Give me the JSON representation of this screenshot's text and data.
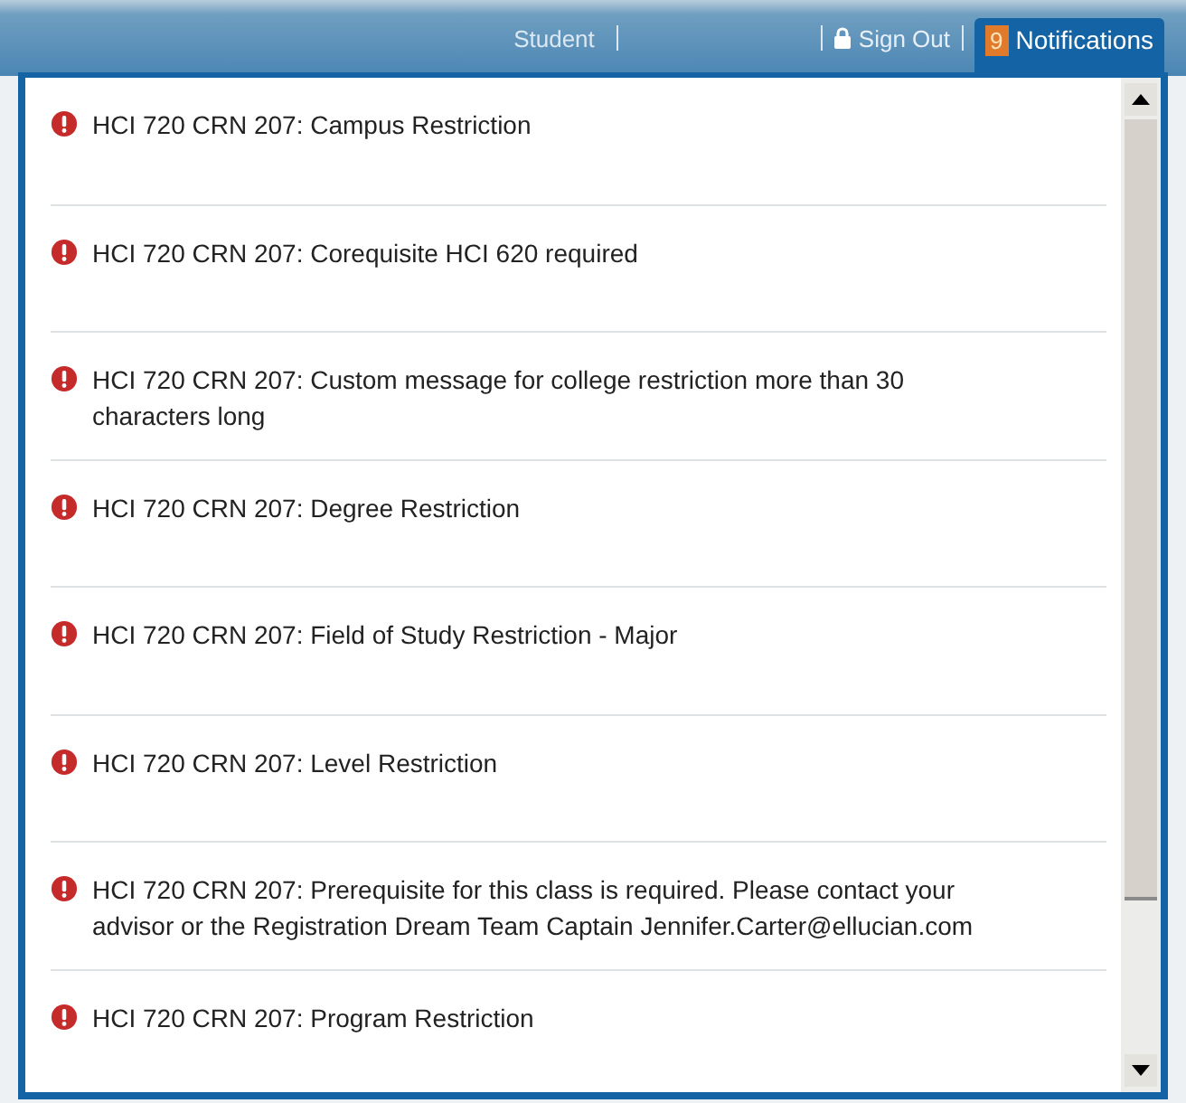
{
  "header": {
    "user": "Student",
    "sign_out": "Sign Out",
    "notifications": {
      "label": "Notifications",
      "count": "9",
      "selected": true
    }
  },
  "notifications": [
    {
      "message": "HCI 720 CRN 207: Campus Restriction"
    },
    {
      "message": "HCI 720 CRN 207: Corequisite HCI 620 required"
    },
    {
      "message": "HCI 720 CRN 207: Custom message for college restriction more than 30 characters long"
    },
    {
      "message": "HCI 720 CRN 207: Degree Restriction"
    },
    {
      "message": "HCI 720 CRN 207: Field of Study Restriction - Major"
    },
    {
      "message": "HCI 720 CRN 207: Level Restriction"
    },
    {
      "message": "HCI 720 CRN 207: Prerequisite for this class is required. Please contact your advisor or the Registration Dream Team Captain Jennifer.Carter@ellucian.com"
    },
    {
      "message": "HCI 720 CRN 207: Program Restriction"
    }
  ]
}
